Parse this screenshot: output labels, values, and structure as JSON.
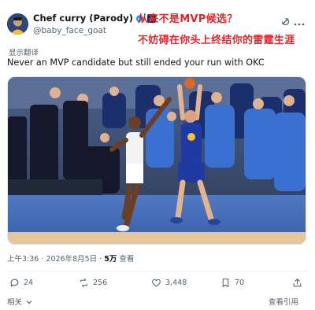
{
  "header": {
    "display_name": "Chef curry (Parody)",
    "handle": "@baby_face_goat",
    "verified_icon": "verified-badge-icon",
    "affiliate_icon": "affiliate-badge-icon"
  },
  "overlay": {
    "line1": "从来不是MVP候选？",
    "line2": "不妨碍在你头上终结你的雷霆生涯",
    "color": "#e0262a"
  },
  "translate_label": "显示翻译",
  "tweet_text": "Never an MVP candidate but still ended your run with OKC",
  "meta": {
    "time": "上午3:36",
    "date": "2026年8月5日",
    "views_count": "5万",
    "views_label": "查看"
  },
  "actions": {
    "replies": "24",
    "retweets": "256",
    "likes": "3,448",
    "bookmarks": "70"
  },
  "footer": {
    "related": "相关",
    "view_quotes": "查看引用"
  },
  "colors": {
    "text_primary": "#0f1419",
    "text_secondary": "#536471",
    "verified_blue": "#1d9bf0"
  }
}
